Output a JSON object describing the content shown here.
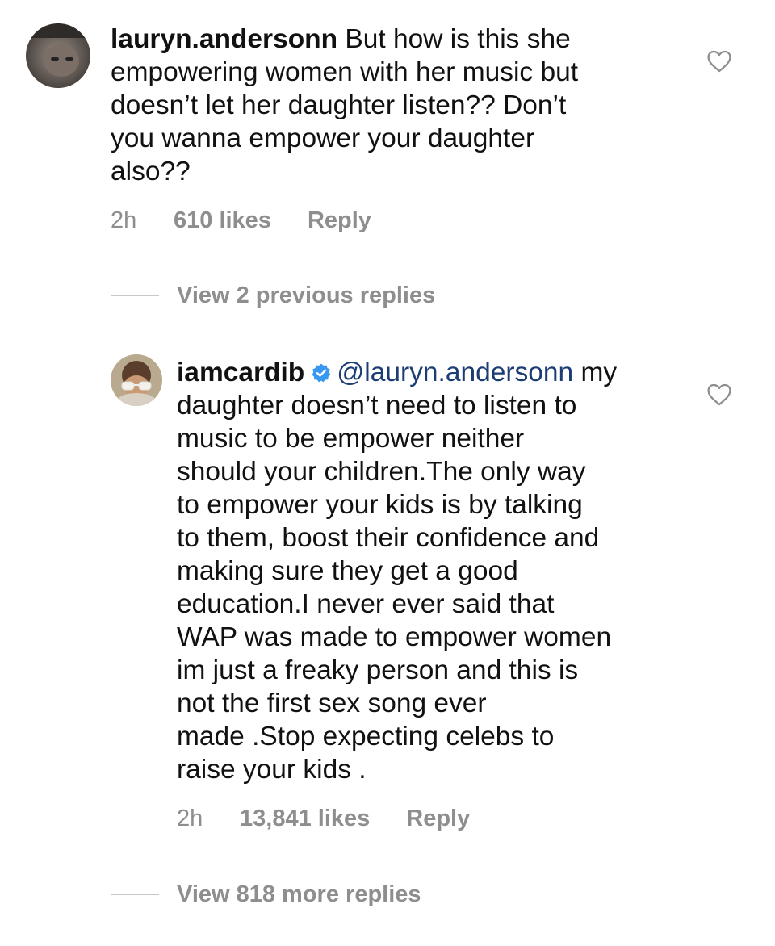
{
  "comments": [
    {
      "username": "lauryn.andersonn",
      "text": "But how is this she\nempowering women with her music but\ndoesn’t let her daughter listen?? Don’t\nyou wanna empower your daughter\nalso??",
      "time": "2h",
      "likes": "610 likes",
      "reply_label": "Reply"
    },
    {
      "username": "iamcardib",
      "mention": "@lauryn.andersonn",
      "text_first": "my",
      "text": "daughter doesn’t need to listen to\nmusic to be empower neither\nshould your children.The only way\nto empower your kids is by talking\nto them, boost their confidence and\nmaking sure they get a good\neducation.I never ever said that\nWAP was made to empower women\nim just a freaky person and this is\nnot the first sex song ever\nmade .Stop expecting celebs to\nraise your kids .",
      "time": "2h",
      "likes": "13,841 likes",
      "reply_label": "Reply"
    }
  ],
  "view_previous": "View 2 previous replies",
  "view_more": "View 818 more replies",
  "icons": {
    "heart": "heart-outline-icon",
    "verified": "verified-badge-icon",
    "verified_color": "#3897f0"
  }
}
